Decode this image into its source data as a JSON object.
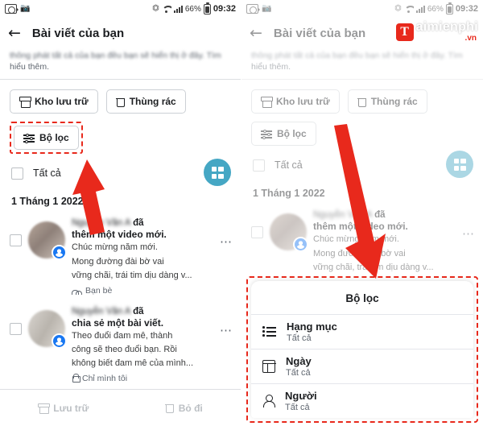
{
  "statusbar": {
    "camera_icon": "camera-icon",
    "photos_icon": "photo-icon",
    "mute_icon": "mute-icon",
    "wifi_icon": "wifi-icon",
    "signal_icon": "signal-icon",
    "battery_text": "66%",
    "battery_icon": "battery-icon",
    "time_left": "09:32",
    "time_right": "09:32"
  },
  "appbar": {
    "back_icon": "back-arrow-icon",
    "title": "Bài viết của bạn"
  },
  "notice": {
    "line1": "thông phát tất cả của bạn đều bạn sẽ hiển thị ở đây. Tìm",
    "line2": "hiểu thêm."
  },
  "chips": {
    "archive": {
      "label": "Kho lưu trữ",
      "icon": "archive-box-icon"
    },
    "trash": {
      "label": "Thùng rác",
      "icon": "trash-icon"
    },
    "filter": {
      "label": "Bộ lọc",
      "icon": "filter-sliders-icon"
    }
  },
  "select_all": {
    "label": "Tất cả",
    "checkbox": "unchecked",
    "grid_button_icon": "grid-view-icon",
    "grid_button_color": "#45a7c4"
  },
  "date_header": "1 Tháng 1 2022",
  "posts": [
    {
      "author_blurred": "Nguyễn Văn A",
      "action_suffix": "đã",
      "headline": "thêm một video mới.",
      "body_line1": "Chúc mừng năm mới.",
      "body_line2": "Mong đường đài bờ vai",
      "body_line3": "vững chãi, trái tim dịu dàng v...",
      "audience": "Bạn bè",
      "audience_icon": "friends-icon",
      "menu_icon": "more-options-icon",
      "checkbox": "unchecked",
      "avatar": "avatar-blurred",
      "badge_icon": "facebook-profile-badge-icon"
    },
    {
      "author_blurred": "Nguyễn Văn A",
      "action_suffix": "đã",
      "headline": "chia sẻ một bài viết.",
      "body_line1": "Theo đuổi đam mê, thành",
      "body_line2": "công sẽ theo đuổi bạn. Rồi",
      "body_line3": "không biết đam mê của mình...",
      "audience": "Chỉ mình tôi",
      "audience_icon": "lock-icon",
      "menu_icon": "more-options-icon",
      "checkbox": "unchecked",
      "avatar": "avatar-blurred",
      "badge_icon": "facebook-profile-badge-icon"
    }
  ],
  "bottombar": {
    "archive": {
      "label": "Lưu trữ",
      "icon": "archive-box-icon",
      "state": "disabled"
    },
    "discard": {
      "label": "Bỏ đi",
      "icon": "trash-icon",
      "state": "disabled"
    }
  },
  "filter_sheet": {
    "title": "Bộ lọc",
    "rows": [
      {
        "label": "Hạng mục",
        "value": "Tất cả",
        "icon": "list-icon"
      },
      {
        "label": "Ngày",
        "value": "Tất cả",
        "icon": "calendar-icon"
      },
      {
        "label": "Người",
        "value": "Tất cả",
        "icon": "person-icon"
      }
    ]
  },
  "annotations": {
    "highlight_color": "#e8291c",
    "arrow_left": "red-arrow-pointing-to-filter-chip",
    "arrow_right": "red-arrow-pointing-to-filter-sheet"
  },
  "watermark": {
    "badge": "T",
    "name": "aimienphi",
    "tld": ".vn"
  }
}
